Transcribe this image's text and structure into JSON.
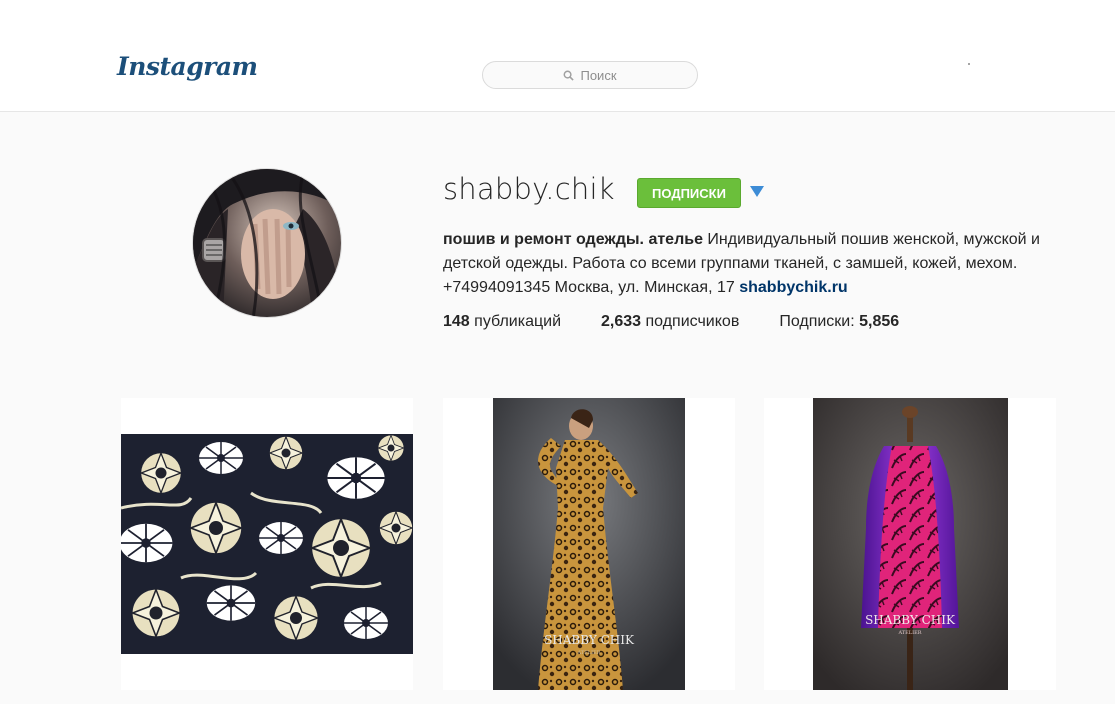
{
  "header": {
    "logo": "Instagram",
    "search_placeholder": "Поиск"
  },
  "profile": {
    "username": "shabby.chik",
    "follow_button": "ПОДПИСКИ",
    "bio_title": "пошив и ремонт одежды. ателье",
    "bio_text": " Индивидуальный пошив женской, мужской и детской одежды. Работа со всеми группами тканей, с замшей, кожей, мехом. +74994091345 Москва, ул. Минская, 17 ",
    "website": "shabbychik.ru",
    "stats": {
      "posts_count": "148",
      "posts_label": " публикаций",
      "followers_count": "2,633",
      "followers_label": " подписчиков",
      "following_label": "Подписки: ",
      "following_count": "5,856"
    }
  },
  "posts": [
    {
      "alt": "floral fabric"
    },
    {
      "alt": "leopard print dress",
      "watermark": "SHABBY CHIK",
      "watermark_sub": "ATELIER"
    },
    {
      "alt": "pink leaf print dress",
      "watermark": "SHABBY CHIK",
      "watermark_sub": "ATELIER"
    }
  ],
  "colors": {
    "follow_green": "#6bbf3b",
    "link_blue": "#003569",
    "logo_blue": "#1c4f7a",
    "dropdown_blue": "#3d8cd6"
  }
}
